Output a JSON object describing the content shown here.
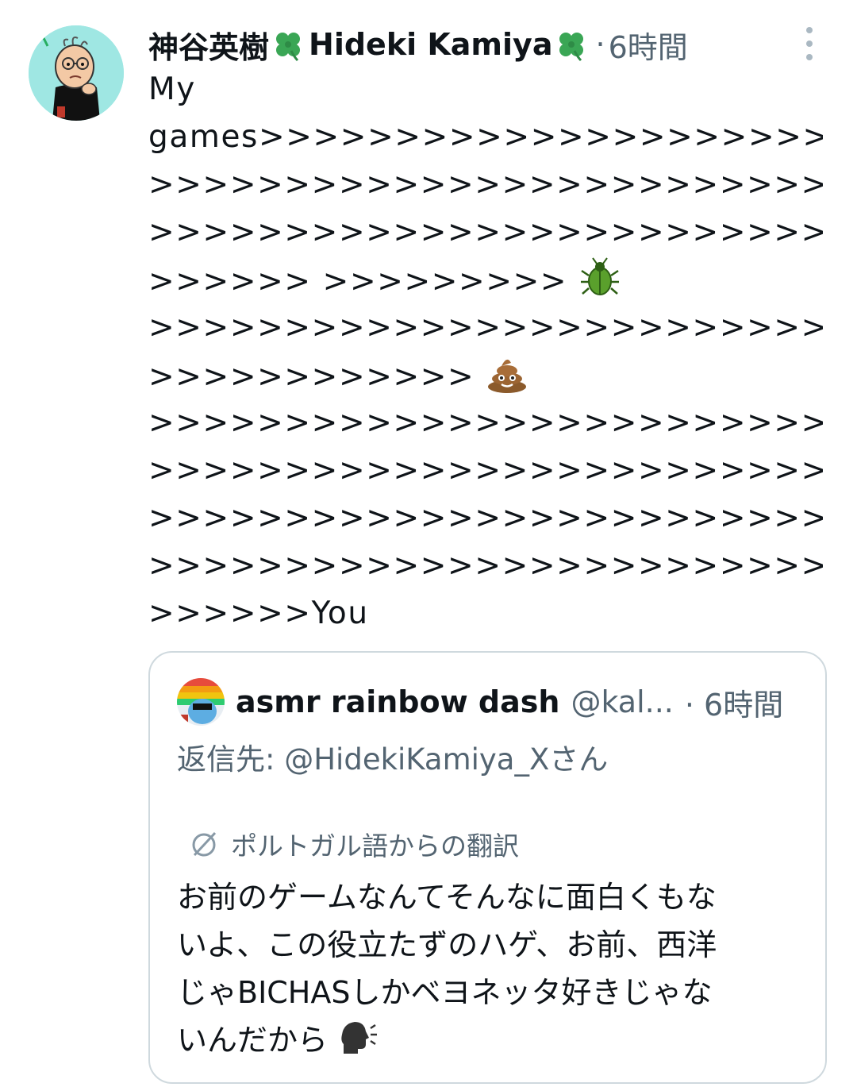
{
  "tweet": {
    "author_name": "神谷英樹",
    "author_name_en": "Hideki Kamiya",
    "separator": "·",
    "timestamp": "6時間",
    "name_emoji": "four-leaf-clover",
    "lines": [
      {
        "text": "My"
      },
      {
        "text": "games>>>>>>>>>>>>>>>>>>>>>>>>>>"
      },
      {
        "text": ">>>>>>>>>>>>>>>>>>>>>>>>>>>"
      },
      {
        "text": ">>>>>>>>>>>>>>>>>>>>>>>>>>>>>>>>"
      },
      {
        "text": ">>>>>> >>>>>>>>> ",
        "emoji": "beetle"
      },
      {
        "text": ">>>>>>>>>>>>>>>>>>>>>>>>>>>>>>>>"
      },
      {
        "text": ">>>>>>>>>>>>",
        "emoji": "pile-of-poo"
      },
      {
        "text": ">>>>>>>>>>>>>>>>>>>>>>>>>>>>>>>>"
      },
      {
        "text": ">>>>>>>>>>>>>>>>>>>>>>>>>>>>>>>>"
      },
      {
        "text": ">>>>>>>>>>>>>>>>>>>>>>>>>>>>>>>>"
      },
      {
        "text": ">>>>>>>>>>>>>>>>>>>>>>>>>>>>>>>>"
      },
      {
        "text": ">>>>>>You"
      }
    ]
  },
  "quote": {
    "author_name": "asmr rainbow dash",
    "handle": "@kal...",
    "timestamp": "· 6時間",
    "reply_to": "返信先: @HidekiKamiya_Xさん",
    "translation_label": "ポルトガル語からの翻訳",
    "lines": [
      {
        "text": "お前のゲームなんてそんなに面白くもな"
      },
      {
        "text": "いよ、この役立たずのハゲ、お前、西洋"
      },
      {
        "text": "じゃBICHASしかベヨネッタ好きじゃな"
      },
      {
        "text": "いんだから",
        "emoji": "speaking-head"
      }
    ]
  },
  "colors": {
    "text_primary": "#0f1419",
    "text_secondary": "#536471",
    "card_border": "#cfd9de",
    "avatar_bg": "#9fe7e3"
  }
}
